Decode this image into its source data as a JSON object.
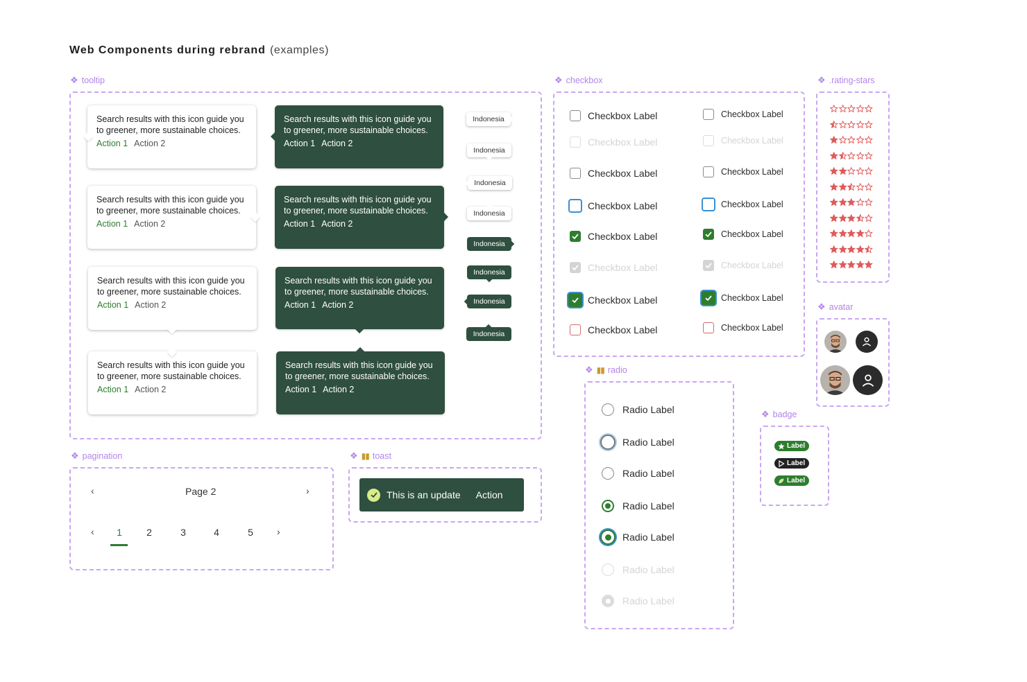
{
  "title": "Web Components during rebrand",
  "title_suffix": "(examples)",
  "frames": {
    "tooltip": "tooltip",
    "checkbox": "checkbox",
    "rating_stars": ".rating-stars",
    "avatar": "avatar",
    "radio": "radio",
    "badge": "badge",
    "pagination": "pagination",
    "toast": "toast"
  },
  "tooltip": {
    "text": "Search results with this icon guide you to greener, more sustainable choices.",
    "action1": "Action 1",
    "action2": "Action 2",
    "pill_text": "Indonesia"
  },
  "checkbox": {
    "label": "Checkbox Label",
    "states": [
      "default",
      "disabled",
      "default",
      "focus",
      "checked",
      "checked-disabled",
      "checked-focus",
      "error"
    ]
  },
  "rating": {
    "color": "#e05a5a",
    "values": [
      0,
      0.5,
      1,
      1.5,
      2,
      2.5,
      3,
      3.5,
      4,
      4.5,
      5
    ],
    "max": 5
  },
  "radio": {
    "label": "Radio Label",
    "states": [
      "default",
      "focus",
      "default",
      "checked",
      "checked-focus",
      "disabled",
      "checked-disabled"
    ]
  },
  "badges": [
    {
      "label": "Label",
      "icon": "star-icon",
      "color": "#2e7d2e"
    },
    {
      "label": "Label",
      "icon": "play-icon",
      "color": "#222222"
    },
    {
      "label": "Label",
      "icon": "leaf-icon",
      "color": "#2e7d2e"
    }
  ],
  "pagination": {
    "page_label": "Page 2",
    "pages": [
      "1",
      "2",
      "3",
      "4",
      "5"
    ],
    "active_page": "1"
  },
  "toast": {
    "message": "This is an update",
    "action": "Action"
  },
  "colors": {
    "brand_dark": "#2f4f40",
    "brand_green": "#2e7d2e",
    "frame_dashed": "#c8a6f3",
    "focus_blue": "#3b8fd0",
    "error_red": "#d46a6a"
  }
}
